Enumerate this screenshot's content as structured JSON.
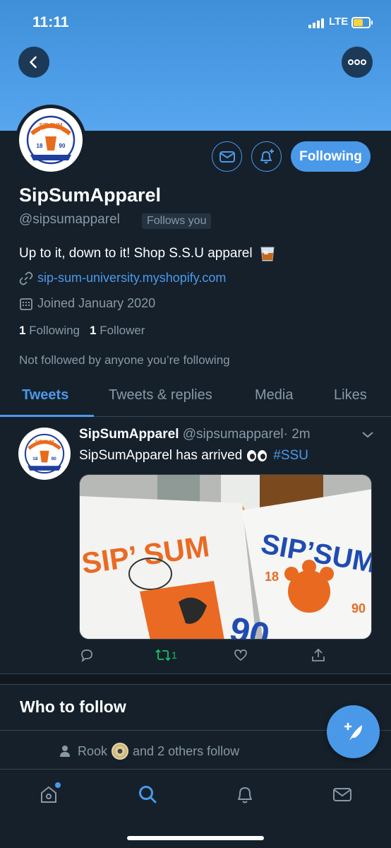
{
  "status_bar": {
    "time": "11:11",
    "network": "LTE",
    "battery_level": 0.6
  },
  "profile": {
    "display_name": "SipSumApparel",
    "handle": "@sipsumapparel",
    "follows_you_badge": "Follows you",
    "bio": "Up to it, down to it! Shop S.S.U apparel",
    "website": "sip-sum-university.myshopify.com",
    "joined": "Joined January 2020",
    "following_count": "1",
    "following_label": "Following",
    "followers_count": "1",
    "followers_label": "Follower",
    "followers_context": "Not followed by anyone you’re following",
    "follow_button_label": "Following",
    "logo": {
      "line1": "SIP SUM",
      "line2": "UNIVERSITY",
      "year_left": "18",
      "year_right": "90"
    }
  },
  "tabs": [
    {
      "label": "Tweets",
      "active": true
    },
    {
      "label": "Tweets & replies",
      "active": false
    },
    {
      "label": "Media",
      "active": false
    },
    {
      "label": "Likes",
      "active": false
    }
  ],
  "tweet": {
    "author_name": "SipSumApparel",
    "author_handle": "@sipsumapparel",
    "time": "· 2m",
    "text": "SipSumApparel has arrived",
    "hashtag": "#SSU",
    "retweet_count": "1",
    "media": {
      "shirt_left_text": "SIP’ SUM",
      "shirt_right_text": "SIP’SUM",
      "year_left": "18",
      "year_right": "90"
    }
  },
  "who_to_follow": {
    "title": "Who to follow",
    "context_name": "Rook",
    "context_suffix": "and 2 others follow"
  },
  "colors": {
    "accent": "#4a99e9",
    "background": "#15202b",
    "retweet": "#17bf63",
    "muted": "#8899a6"
  }
}
